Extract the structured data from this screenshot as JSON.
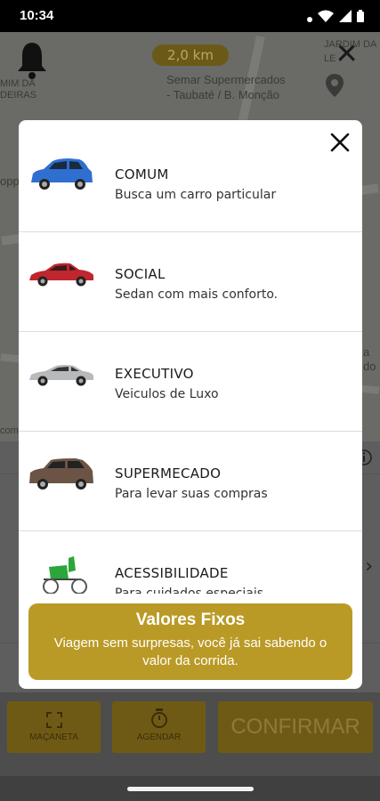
{
  "status_bar": {
    "time": "10:34"
  },
  "map": {
    "distance": "2,0 km",
    "place_name": "Semar Supermercados",
    "place_address": "- Taubaté / B. Monção",
    "edge_label_top_right": "JARDIM DA LE",
    "edge_label_left_1": "MIM DA",
    "edge_label_left_2": "DEIRAS",
    "edge_label_left_3": "opp",
    "edge_label_right": "a do",
    "edge_label_bottom": "com"
  },
  "modal": {
    "categories": [
      {
        "title": "COMUM",
        "subtitle": "Busca um carro particular",
        "car_color": "#2f6fd0"
      },
      {
        "title": "SOCIAL",
        "subtitle": "Sedan com mais conforto.",
        "car_color": "#c0262e"
      },
      {
        "title": "EXECUTIVO",
        "subtitle": "Veiculos de Luxo",
        "car_color": "#b7b9bb"
      },
      {
        "title": "SUPERMECADO",
        "subtitle": "Para levar suas compras",
        "car_color": "#6b5446"
      },
      {
        "title": "ACESSIBILIDADE",
        "subtitle": "Para cuidados especiais",
        "car_color": "#2aa63a"
      }
    ],
    "banner": {
      "title": "Valores Fixos",
      "subtitle": "Viagem sem surpresas, você já sai sabendo o valor da corrida."
    }
  },
  "bottom_bar": {
    "macaneta_label": "MAÇANETA",
    "agendar_label": "AGENDAR",
    "confirm_label": "CONFIRMAR"
  },
  "colors": {
    "accent": "#ba9a26",
    "accent_dimmed": "#6f5a15"
  }
}
